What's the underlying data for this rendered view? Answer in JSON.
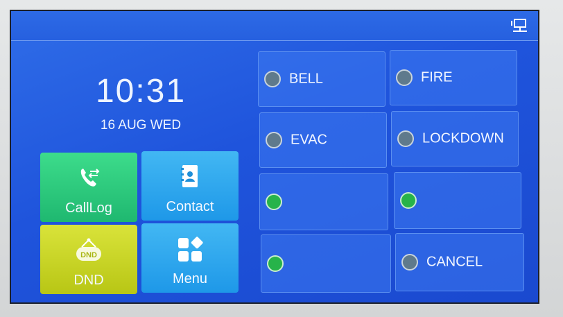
{
  "status_bar": {
    "network_icon": "network-icon"
  },
  "clock": {
    "time": "10:31",
    "date": "16 AUG WED"
  },
  "tiles": [
    {
      "key": "calllog",
      "label": "CallLog",
      "icon": "phone-list-icon",
      "color": "#2bc97c"
    },
    {
      "key": "contact",
      "label": "Contact",
      "icon": "address-book-icon",
      "color": "#2fa6ee"
    },
    {
      "key": "dnd",
      "label": "DND",
      "icon": "dnd-sign-icon",
      "color": "#c9d42a"
    },
    {
      "key": "menu",
      "label": "Menu",
      "icon": "menu-grid-icon",
      "color": "#2fa6ee"
    }
  ],
  "buttons": [
    {
      "label": "BELL",
      "icon": "phone-icon"
    },
    {
      "label": "FIRE",
      "icon": "phone-icon"
    },
    {
      "label": "EVAC",
      "icon": "phone-icon"
    },
    {
      "label": "LOCKDOWN",
      "icon": "phone-icon"
    },
    {
      "label": "",
      "icon": "edit-icon"
    },
    {
      "label": "",
      "icon": "edit-icon"
    },
    {
      "label": "",
      "icon": "edit-icon"
    },
    {
      "label": "CANCEL",
      "icon": "phone-icon"
    }
  ],
  "colors": {
    "screen_bg": "#2360e0",
    "button_border": "#5b8ff0"
  }
}
